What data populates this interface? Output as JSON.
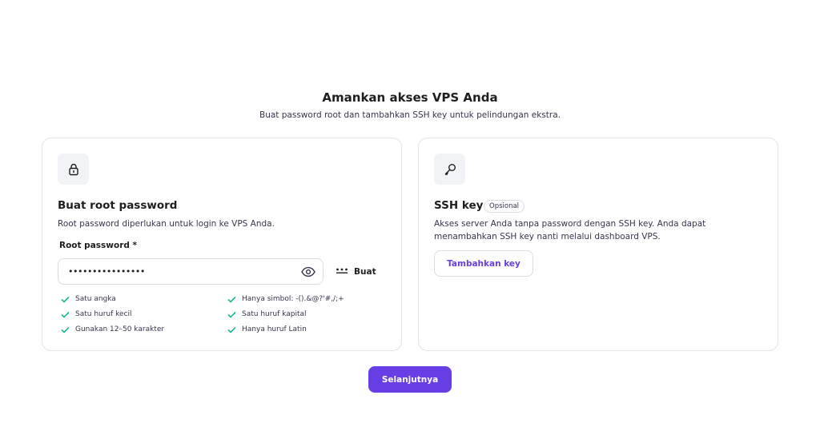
{
  "header": {
    "title": "Amankan akses VPS Anda",
    "subtitle": "Buat password root dan tambahkan SSH key untuk pelindungan ekstra."
  },
  "password_card": {
    "icon": "lock-icon",
    "title": "Buat root password",
    "description": "Root password diperlukan untuk login ke VPS Anda.",
    "field_label": "Root password *",
    "field_value": "••••••••••••••••",
    "reveal_icon": "eye-icon",
    "generate_icon": "dots-icon",
    "generate_label": "Buat",
    "requirements_col1": [
      "Satu angka",
      "Satu huruf kecil",
      "Gunakan 12–50 karakter"
    ],
    "requirements_col2": [
      "Hanya simbol: -().&@?'#,/;+",
      "Satu huruf kapital",
      "Hanya huruf Latin"
    ],
    "check_color": "#00b090"
  },
  "ssh_card": {
    "icon": "key-icon",
    "title": "SSH key",
    "badge": "Opsional",
    "description": "Akses server Anda tanpa password dengan SSH key. Anda dapat menambahkan SSH key nanti melalui dashboard VPS.",
    "button_label": "Tambahkan key"
  },
  "footer": {
    "next_label": "Selanjutnya"
  },
  "colors": {
    "accent": "#673de6",
    "border": "#e3e3e8",
    "icon_bg": "#f2f3f6"
  }
}
